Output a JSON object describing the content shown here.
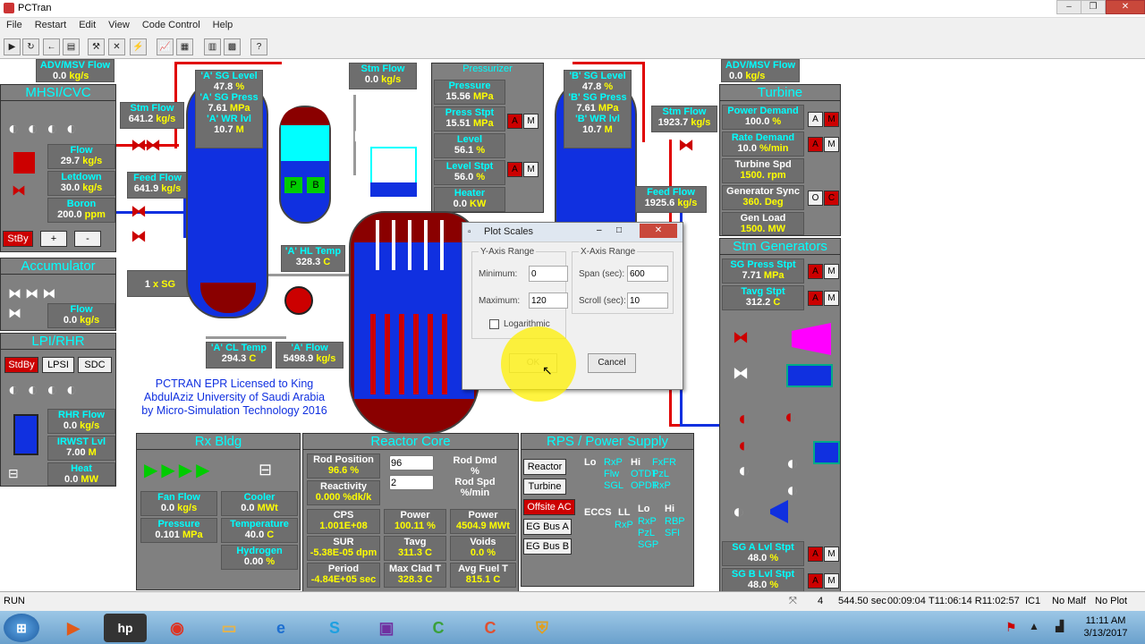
{
  "window": {
    "title": "PCTran"
  },
  "menu": [
    "File",
    "Restart",
    "Edit",
    "View",
    "Code Control",
    "Help"
  ],
  "adv_left": {
    "label": "ADV/MSV Flow",
    "value": "0.0",
    "unit": "kg/s"
  },
  "adv_right": {
    "label": "ADV/MSV Flow",
    "value": "0.0",
    "unit": "kg/s"
  },
  "stm_flow_top": {
    "label": "Stm Flow",
    "value": "0.0",
    "unit": "kg/s"
  },
  "mhsi": {
    "title": "MHSI/CVC",
    "flow_label": "Flow",
    "flow": "29.7",
    "flow_unit": "kg/s",
    "letdown_label": "Letdown",
    "letdown": "30.0",
    "letdown_unit": "kg/s",
    "boron_label": "Boron",
    "boron": "200.0",
    "boron_unit": "ppm",
    "stby": "StBy",
    "plus": "+",
    "minus": "-"
  },
  "accumulator": {
    "title": "Accumulator",
    "flow_label": "Flow",
    "flow": "0.0",
    "unit": "kg/s"
  },
  "lpi": {
    "title": "LPI/RHR",
    "stby": "StdBy",
    "lpsi": "LPSI",
    "sdc": "SDC",
    "rhr_label": "RHR Flow",
    "rhr": "0.0",
    "rhr_unit": "kg/s",
    "irwst_label": "IRWST Lvl",
    "irwst": "7.00",
    "irwst_unit": "M",
    "heat_label": "Heat",
    "heat": "0.0",
    "heat_unit": "MW"
  },
  "sg_a": {
    "level_label": "'A' SG Level",
    "level": "47.8",
    "level_unit": "%",
    "press_label": "'A' SG Press",
    "press": "7.61",
    "press_unit": "MPa",
    "wr_label": "'A' WR lvl",
    "wr": "10.7",
    "wr_unit": "M"
  },
  "sg_b": {
    "level_label": "'B' SG Level",
    "level": "47.8",
    "level_unit": "%",
    "press_label": "'B' SG Press",
    "press": "7.61",
    "press_unit": "MPa",
    "wr_label": "'B' WR lvl",
    "wr": "10.7",
    "wr_unit": "M"
  },
  "stm_flow_a": {
    "label": "Stm Flow",
    "value": "641.2",
    "unit": "kg/s"
  },
  "stm_flow_b": {
    "label": "Stm Flow",
    "value": "1923.7",
    "unit": "kg/s"
  },
  "feed_a": {
    "label": "Feed Flow",
    "value": "641.9",
    "unit": "kg/s"
  },
  "feed_b": {
    "label": "Feed Flow",
    "value": "1925.6",
    "unit": "kg/s"
  },
  "sg_count": {
    "value": "1",
    "unit": "x SG"
  },
  "hl_temp": {
    "label": "'A' HL Temp",
    "value": "328.3",
    "unit": "C"
  },
  "cl_temp": {
    "label": "'A' CL Temp",
    "value": "294.3",
    "unit": "C"
  },
  "a_flow": {
    "label": "'A' Flow",
    "value": "5498.9",
    "unit": "kg/s"
  },
  "pressurizer": {
    "title": "Pressurizer",
    "pressure_label": "Pressure",
    "pressure": "15.56",
    "pressure_unit": "MPa",
    "stpt_label": "Press Stpt",
    "stpt": "15.51",
    "stpt_unit": "MPa",
    "level_label": "Level",
    "level": "56.1",
    "level_unit": "%",
    "lstpt_label": "Level Stpt",
    "lstpt": "56.0",
    "lstpt_unit": "%",
    "heater_label": "Heater",
    "heater": "0.0",
    "heater_unit": "KW",
    "a": "A",
    "m": "M",
    "p": "P",
    "b": "B"
  },
  "license": [
    "PCTRAN EPR Licensed to King",
    "AbdulAziz University of Saudi Arabia",
    "by Micro-Simulation Technology 2016"
  ],
  "turbine": {
    "title": "Turbine",
    "pd_label": "Power Demand",
    "pd": "100.0",
    "pd_unit": "%",
    "rd_label": "Rate Demand",
    "rd": "10.0",
    "rd_unit": "%/min",
    "ts_label": "Turbine Spd",
    "ts": "1500.",
    "ts_unit": "rpm",
    "gs_label": "Generator Sync",
    "gs": "360.",
    "gs_unit": "Deg",
    "gl_label": "Gen Load",
    "gl": "1500.",
    "gl_unit": "MW",
    "a": "A",
    "m": "M",
    "o": "O",
    "c": "C"
  },
  "stm_gen": {
    "title": "Stm Generators",
    "sgp_label": "SG Press Stpt",
    "sgp": "7.71",
    "sgp_unit": "MPa",
    "tavg_label": "Tavg Stpt",
    "tavg": "312.2",
    "tavg_unit": "C",
    "sga_label": "SG A Lvl Stpt",
    "sga": "48.0",
    "sga_unit": "%",
    "sgb_label": "SG B Lvl Stpt",
    "sgb": "48.0",
    "sgb_unit": "%",
    "a": "A",
    "m": "M"
  },
  "rx_bldg": {
    "title": "Rx Bldg",
    "fan_label": "Fan Flow",
    "fan": "0.0",
    "fan_unit": "kg/s",
    "cooler_label": "Cooler",
    "cooler": "0.0",
    "cooler_unit": "MWt",
    "press_label": "Pressure",
    "press": "0.101",
    "press_unit": "MPa",
    "temp_label": "Temperature",
    "temp": "40.0",
    "temp_unit": "C",
    "h2_label": "Hydrogen",
    "h2": "0.00",
    "h2_unit": "%"
  },
  "core": {
    "title": "Reactor Core",
    "rodpos_label": "Rod Position",
    "rodpos": "96.6",
    "rodpos_unit": "%",
    "rod_input": "96",
    "rod_dmd": "Rod Dmd",
    "rod_dmd_unit": "%",
    "spd_input": "2",
    "rod_spd": "Rod Spd",
    "rod_spd_unit": "%/min",
    "react_label": "Reactivity",
    "react": "0.000",
    "react_unit": "%dk/k",
    "cps_label": "CPS",
    "cps": "1.001E+08",
    "power_label": "Power",
    "power": "100.11",
    "power_unit": "%",
    "powerm_label": "Power",
    "powerm": "4504.9",
    "powerm_unit": "MWt",
    "sur_label": "SUR",
    "sur": "-5.38E-05",
    "sur_unit": "dpm",
    "tavg_label": "Tavg",
    "tavg": "311.3",
    "tavg_unit": "C",
    "voids_label": "Voids",
    "voids": "0.0",
    "voids_unit": "%",
    "period_label": "Period",
    "period": "-4.84E+05",
    "period_unit": "sec",
    "mct_label": "Max Clad T",
    "mct": "328.3",
    "mct_unit": "C",
    "aft_label": "Avg Fuel T",
    "aft": "815.1",
    "aft_unit": "C"
  },
  "rps": {
    "title": "RPS / Power Supply",
    "reactor": "Reactor",
    "turbine": "Turbine",
    "offsite": "Offsite AC",
    "busa": "EG Bus A",
    "busb": "EG Bus B",
    "lo": "Lo",
    "rxp1": "RxP",
    "flw": "Flw",
    "sgl": "SGL",
    "hi": "Hi",
    "otdt": "OTDT",
    "opdt": "OPDT",
    "fxfr": "FxFR",
    "pzl": "PzL",
    "rxp2": "RxP",
    "eccs": "ECCS",
    "ll": "LL",
    "rxp3": "RxP",
    "lo2": "Lo",
    "rxp4": "RxP",
    "pzl2": "PzL",
    "sgp": "SGP",
    "hi2": "Hi",
    "rbp": "RBP",
    "sfi": "SFI"
  },
  "dialog": {
    "title": "Plot Scales",
    "y_group": "Y-Axis Range",
    "x_group": "X-Axis Range",
    "min_label": "Minimum:",
    "min": "0",
    "max_label": "Maximum:",
    "max": "120",
    "span_label": "Span (sec):",
    "span": "600",
    "scroll_label": "Scroll (sec):",
    "scroll": "10",
    "log_label": "Logarithmic",
    "ok": "OK",
    "cancel": "Cancel"
  },
  "status": {
    "mode": "RUN",
    "num": "4",
    "sec": "544.50 sec",
    "elapsed": "00:09:04",
    "time": "T11:06:14 R11:02:57",
    "ic": "IC1",
    "malf": "No Malf",
    "plot": "No Plot"
  },
  "clock": {
    "time": "11:11 AM",
    "date": "3/13/2017"
  }
}
